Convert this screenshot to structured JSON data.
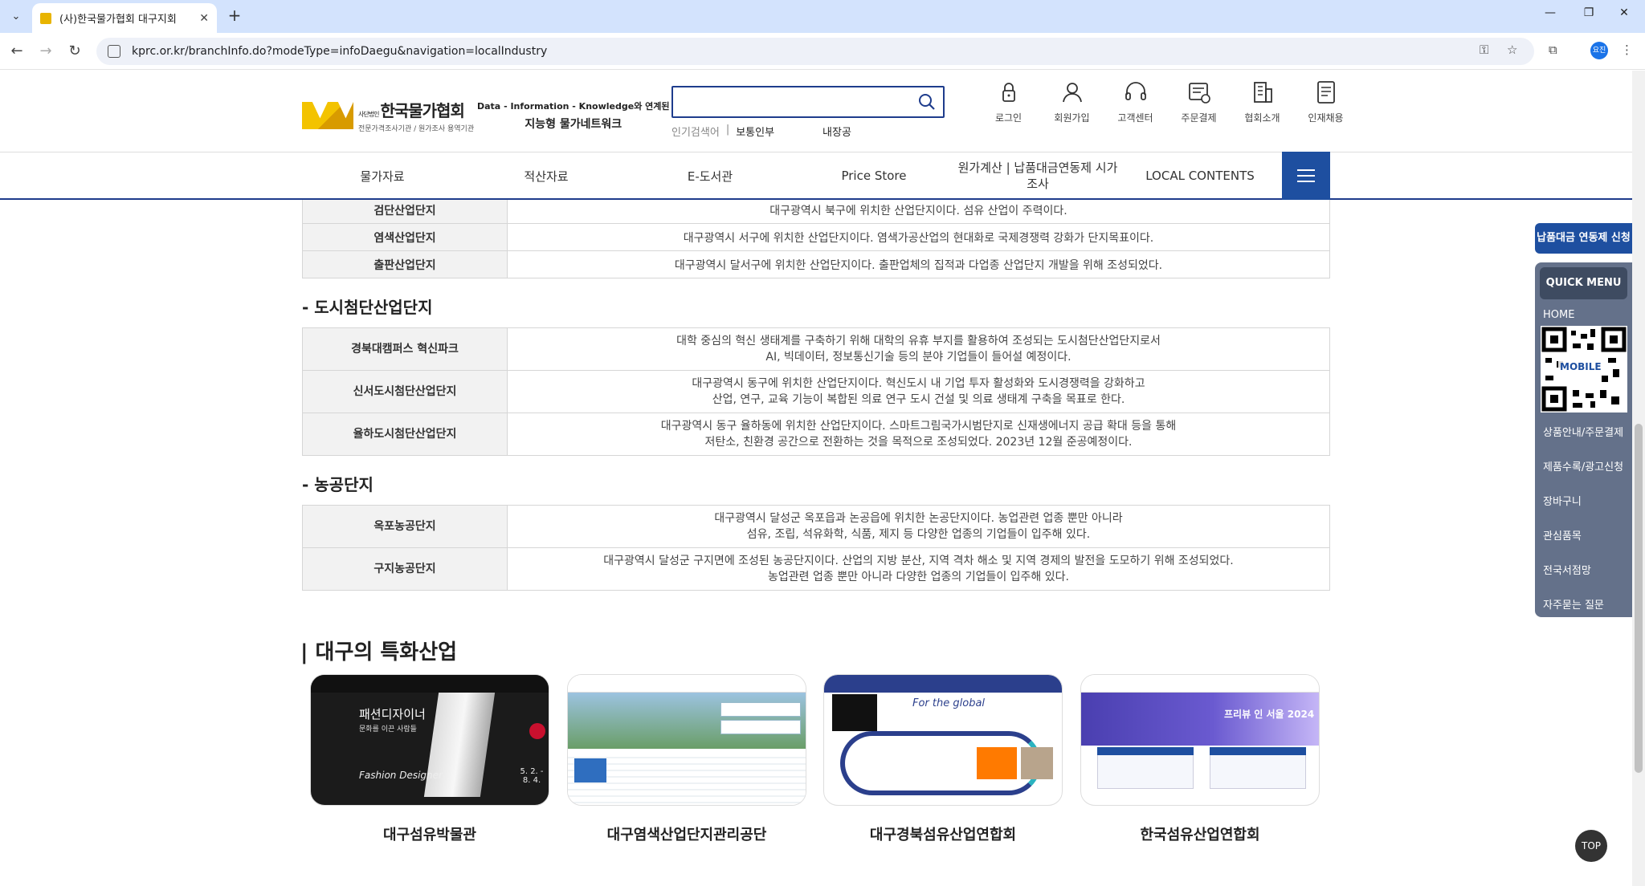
{
  "browser": {
    "tab_title": "(사)한국물가협회 대구지회",
    "url": "kprc.or.kr/branchInfo.do?modeType=infoDaegu&navigation=localIndustry",
    "profile_label": "요진"
  },
  "header": {
    "logo_main": "한국물가협회",
    "logo_small": "사단법인",
    "logo_sub": "전문가격조사기관 / 원가조사 용역기관",
    "slogan_line1": "Data - Information - Knowledge와 연계된",
    "slogan_line2": "지능형 물가네트워크",
    "popular_label": "인기검색어",
    "popular_sep": "|",
    "popular_keywords": [
      "보통인부",
      "내장공"
    ],
    "util": [
      {
        "label": "로그인",
        "icon": "lock-icon"
      },
      {
        "label": "회원가입",
        "icon": "user-icon"
      },
      {
        "label": "고객센터",
        "icon": "headset-icon"
      },
      {
        "label": "주문결제",
        "icon": "order-icon"
      },
      {
        "label": "협회소개",
        "icon": "building-icon"
      },
      {
        "label": "인재채용",
        "icon": "document-icon"
      }
    ]
  },
  "gnb": {
    "items": [
      "물가자료",
      "적산자료",
      "E-도서관",
      "Price Store",
      "원가계산 | 납품대금연동제 시가조사",
      "LOCAL CONTENTS"
    ]
  },
  "tables": {
    "top_rows": [
      {
        "name": "검단산업단지",
        "desc": "대구광역시 북구에 위치한 산업단지이다. 섬유 산업이 주력이다."
      },
      {
        "name": "염색산업단지",
        "desc": "대구광역시 서구에 위치한 산업단지이다. 염색가공산업의 현대화로 국제경쟁력 강화가 단지목표이다."
      },
      {
        "name": "출판산업단지",
        "desc": "대구광역시 달서구에 위치한 산업단지이다. 출판업체의 집적과 다업종 산업단지 개발을 위해 조성되었다."
      }
    ],
    "urban_title": "- 도시첨단산업단지",
    "urban_rows": [
      {
        "name": "경북대캠퍼스 혁신파크",
        "desc1": "대학 중심의 혁신 생태계를 구축하기 위해 대학의 유휴 부지를 활용하여 조성되는 도시첨단산업단지로서",
        "desc2": "AI, 빅데이터, 정보통신기술 등의 분야 기업들이 들어설 예정이다."
      },
      {
        "name": "신서도시첨단산업단지",
        "desc1": "대구광역시 동구에 위치한 산업단지이다. 혁신도시 내 기업 투자 활성화와 도시경쟁력을 강화하고",
        "desc2": "산업, 연구, 교육 기능이 복합된 의료 연구 도시 건설 및 의료 생태계 구축을 목표로 한다."
      },
      {
        "name": "율하도시첨단산업단지",
        "desc1": "대구광역시 동구 율하동에 위치한 산업단지이다. 스마트그림국가시범단지로 신재생에너지 공급 확대 등을 통해",
        "desc2": "저탄소, 친환경 공간으로 전환하는 것을 목적으로 조성되었다. 2023년 12월 준공예정이다."
      }
    ],
    "agri_title": "- 농공단지",
    "agri_rows": [
      {
        "name": "옥포농공단지",
        "desc1": "대구광역시 달성군 옥포읍과 논공읍에 위치한 논공단지이다. 농업관련 업종 뿐만 아니라",
        "desc2": "섬유, 조립, 석유화학, 식품, 제지 등 다양한 업종의 기업들이 입주해 있다."
      },
      {
        "name": "구지농공단지",
        "desc1": "대구광역시 달성군 구지면에 조성된 농공단지이다. 산업의 지방 분산, 지역 격차 해소 및 지역 경제의 발전을 도모하기 위해 조성되었다.",
        "desc2": "농업관련 업종 뿐만 아니라 다양한 업종의 기업들이 입주해 있다."
      }
    ]
  },
  "specialized": {
    "title": "| 대구의 특화산업",
    "cards": [
      {
        "name": "대구섬유박물관",
        "thumb_text": "패션디자이너",
        "thumb_sub": "문화를 이끈 사람들",
        "thumb_eng": "Fashion Designer",
        "thumb_date": "5. 2. - 8. 4."
      },
      {
        "name": "대구염색산업단지관리공단",
        "thumb_text": ""
      },
      {
        "name": "대구경북섬유산업연합회",
        "thumb_text": "For the global"
      },
      {
        "name": "한국섬유산업연합회",
        "thumb_text": "프리뷰 인 서울 2024"
      }
    ]
  },
  "quick_menu": {
    "top_button": "납품대금 연동제 신청",
    "head": "QUICK MENU",
    "home": "HOME",
    "qr_label": "MOBILE",
    "items": [
      "상품안내/주문결제",
      "제품수록/광고신청",
      "장바구니",
      "관심품목",
      "전국서점망",
      "자주묻는 질문"
    ]
  },
  "top_button": "TOP",
  "colors": {
    "brand_blue": "#1e4fa0",
    "border_navy": "#1e3c8c",
    "quick_bg": "#64718a"
  }
}
